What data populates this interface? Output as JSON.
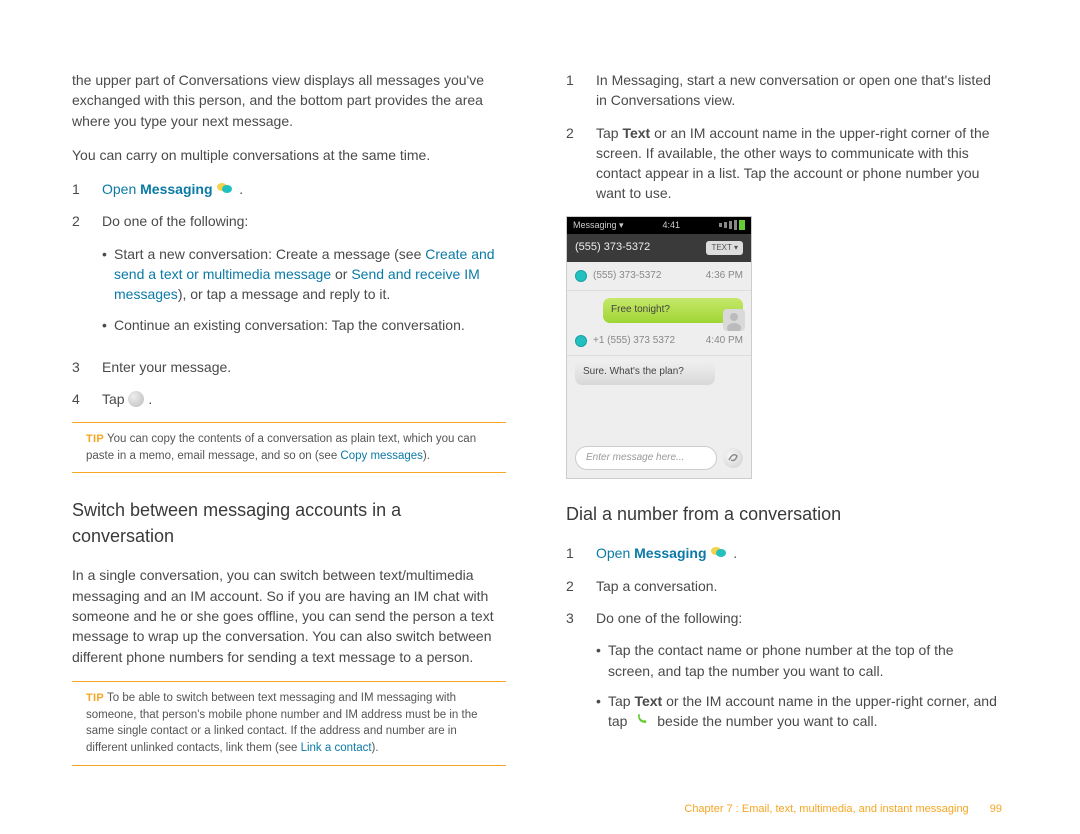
{
  "left": {
    "intro1": "the upper part of Conversations view displays all messages you've exchanged with this person, and the bottom part provides the area where you type your next message.",
    "intro2": "You can carry on multiple conversations at the same time.",
    "step1_open": "Open",
    "step1_messaging": "Messaging",
    "step1_period": ".",
    "step2": "Do one of the following:",
    "bullet1_a": "Start a new conversation: Create a message (see ",
    "bullet1_link1": "Create and send a text or multimedia message",
    "bullet1_b": " or ",
    "bullet1_link2": "Send and receive IM messages",
    "bullet1_c": "), or tap a message and reply to it.",
    "bullet2": "Continue an existing conversation: Tap the conversation.",
    "step3": "Enter your message.",
    "step4": "Tap ",
    "step4b": ".",
    "tip1_label": "TIP",
    "tip1_a": "You can copy the contents of a conversation as plain text, which you can paste in a memo, email message, and so on (see ",
    "tip1_link": "Copy messages",
    "tip1_b": ").",
    "h2": "Switch between messaging accounts in a conversation",
    "para_switch": "In a single conversation, you can switch between text/multimedia messaging and an IM account. So if you are having an IM chat with someone and he or she goes offline, you can send the person a text message to wrap up the conversation. You can also switch between different phone numbers for sending a text message to a person.",
    "tip2_label": "TIP",
    "tip2_a": "To be able to switch between text messaging and IM messaging with someone, that person's mobile phone number and IM address must be in the same single contact or a linked contact. If the address and number are in different unlinked contacts, link them (see ",
    "tip2_link": "Link a contact",
    "tip2_b": ")."
  },
  "right": {
    "step1": "In Messaging, start a new conversation or open one that's listed in Conversations view.",
    "step2_a": "Tap ",
    "step2_text": "Text",
    "step2_b": " or an IM account name in the upper-right corner of the screen. If available, the other ways to communicate with this contact appear in a list. Tap the account or phone number you want to use.",
    "h2": "Dial a number from a conversation",
    "d_step1_open": "Open",
    "d_step1_messaging": "Messaging",
    "d_step1_period": ".",
    "d_step2": "Tap a conversation.",
    "d_step3": "Do one of the following:",
    "d_bullet1": "Tap the contact name or phone number at the top of the screen, and tap the number you want to call.",
    "d_bullet2_a": "Tap ",
    "d_bullet2_text": "Text",
    "d_bullet2_b": " or the IM account name in the upper-right corner, and tap ",
    "d_bullet2_c": " beside the number you want to call."
  },
  "screenshot": {
    "status_app": "Messaging",
    "status_time": "4:41",
    "top_title": "(555) 373-5372",
    "top_badge": "TEXT",
    "row1_num": "(555) 373-5372",
    "row1_time": "4:36 PM",
    "msg_out": "Free tonight?",
    "row2_num": "+1 (555) 373 5372",
    "row2_time": "4:40 PM",
    "msg_in": "Sure. What's the plan?",
    "input_placeholder": "Enter message here..."
  },
  "footer": {
    "chapter": "Chapter 7 : Email, text, multimedia, and instant messaging",
    "page": "99"
  }
}
